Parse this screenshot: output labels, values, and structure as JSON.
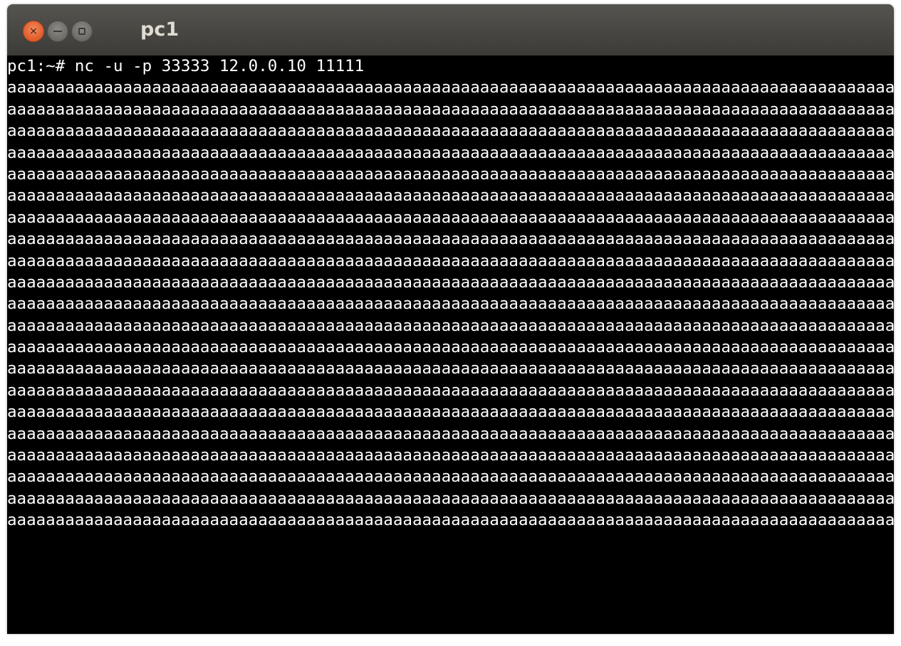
{
  "window": {
    "title": "pc1",
    "buttons": {
      "close_glyph": "×"
    }
  },
  "terminal": {
    "command_line": "pc1:~# nc -u -p 33333 12.0.0.10 11111",
    "output_lines": [
      "aaaaaaaaaaaaaaaaaaaaaaaaaaaaaaaaaaaaaaaaaaaaaaaaaaaaaaaaaaaaaaaaaaaaaaaaaaaaaaaaaaaaaaaaaaaaaaaaaaaaaaaaaaaaaaaaaaaaaaaa",
      "aaaaaaaaaaaaaaaaaaaaaaaaaaaaaaaaaaaaaaaaaaaaaaaaaaaaaaaaaaaaaaaaaaaaaaaaaaaaaaaaaaaaaaaaaaaaaaaaaaaaaaaaaaaaaaaaaaaaaaaa",
      "aaaaaaaaaaaaaaaaaaaaaaaaaaaaaaaaaaaaaaaaaaaaaaaaaaaaaaaaaaaaaaaaaaaaaaaaaaaaaaaaaaaaaaaaaaaaaaaaaaaaaaaaaaaaaaaaaaaaaaaa",
      "aaaaaaaaaaaaaaaaaaaaaaaaaaaaaaaaaaaaaaaaaaaaaaaaaaaaaaaaaaaaaaaaaaaaaaaaaaaaaaaaaaaaaaaaaaaaaaaaaaaaaaaaaaaaaaaaaaaaaaaa",
      "aaaaaaaaaaaaaaaaaaaaaaaaaaaaaaaaaaaaaaaaaaaaaaaaaaaaaaaaaaaaaaaaaaaaaaaaaaaaaaaaaaaaaaaaaaaaaaaaaaaaaaaaaaaaaaaaaaaaaaaa",
      "aaaaaaaaaaaaaaaaaaaaaaaaaaaaaaaaaaaaaaaaaaaaaaaaaaaaaaaaaaaaaaaaaaaaaaaaaaaaaaaaaaaaaaaaaaaaaaaaaaaaaaaaaaaaaaaaaaaaaaaa",
      "aaaaaaaaaaaaaaaaaaaaaaaaaaaaaaaaaaaaaaaaaaaaaaaaaaaaaaaaaaaaaaaaaaaaaaaaaaaaaaaaaaaaaaaaaaaaaaaaaaaaaaaaaaaaaaaaaaaaaaaa",
      "aaaaaaaaaaaaaaaaaaaaaaaaaaaaaaaaaaaaaaaaaaaaaaaaaaaaaaaaaaaaaaaaaaaaaaaaaaaaaaaaaaaaaaaaaaaaaaaaaaaaaaaaaaaaaaaaaaaaaaaa",
      "aaaaaaaaaaaaaaaaaaaaaaaaaaaaaaaaaaaaaaaaaaaaaaaaaaaaaaaaaaaaaaaaaaaaaaaaaaaaaaaaaaaaaaaaaaaaaaaaaaaaaaaaaaaaaaaaaaaaaaaa",
      "aaaaaaaaaaaaaaaaaaaaaaaaaaaaaaaaaaaaaaaaaaaaaaaaaaaaaaaaaaaaaaaaaaaaaaaaaaaaaaaaaaaaaaaaaaaaaaaaaaaaaaaaaaaaaaaaaaaaaaaa",
      "aaaaaaaaaaaaaaaaaaaaaaaaaaaaaaaaaaaaaaaaaaaaaaaaaaaaaaaaaaaaaaaaaaaaaaaaaaaaaaaaaaaaaaaaaaaaaaaaaaaaaaaaaaaaaaaaaaaaaaaa",
      "aaaaaaaaaaaaaaaaaaaaaaaaaaaaaaaaaaaaaaaaaaaaaaaaaaaaaaaaaaaaaaaaaaaaaaaaaaaaaaaaaaaaaaaaaaaaaaaaaaaaaaaaaaaaaaaaaaaaaaaa",
      "aaaaaaaaaaaaaaaaaaaaaaaaaaaaaaaaaaaaaaaaaaaaaaaaaaaaaaaaaaaaaaaaaaaaaaaaaaaaaaaaaaaaaaaaaaaaaaaaaaaaaaaaaaaaaaaaaaaaaaaa",
      "aaaaaaaaaaaaaaaaaaaaaaaaaaaaaaaaaaaaaaaaaaaaaaaaaaaaaaaaaaaaaaaaaaaaaaaaaaaaaaaaaaaaaaaaaaaaaaaaaaaaaaaaaaaaaaaaaaaaaaaa",
      "aaaaaaaaaaaaaaaaaaaaaaaaaaaaaaaaaaaaaaaaaaaaaaaaaaaaaaaaaaaaaaaaaaaaaaaaaaaaaaaaaaaaaaaaaaaaaaaaaaaaaaaaaaaaaaaaaaaaaaaa",
      "aaaaaaaaaaaaaaaaaaaaaaaaaaaaaaaaaaaaaaaaaaaaaaaaaaaaaaaaaaaaaaaaaaaaaaaaaaaaaaaaaaaaaaaaaaaaaaaaaaaaaaaaaaaaaaaaaaaaaaaa",
      "aaaaaaaaaaaaaaaaaaaaaaaaaaaaaaaaaaaaaaaaaaaaaaaaaaaaaaaaaaaaaaaaaaaaaaaaaaaaaaaaaaaaaaaaaaaaaaaaaaaaaaaaaaaaaaaaaaaaaaaa",
      "aaaaaaaaaaaaaaaaaaaaaaaaaaaaaaaaaaaaaaaaaaaaaaaaaaaaaaaaaaaaaaaaaaaaaaaaaaaaaaaaaaaaaaaaaaaaaaaaaaaaaaaaaaaaaaaaaaaaaaaa",
      "aaaaaaaaaaaaaaaaaaaaaaaaaaaaaaaaaaaaaaaaaaaaaaaaaaaaaaaaaaaaaaaaaaaaaaaaaaaaaaaaaaaaaaaaaaaaaaaaaaaaaaaaaaaaaaaaaaaaaaaa",
      "aaaaaaaaaaaaaaaaaaaaaaaaaaaaaaaaaaaaaaaaaaaaaaaaaaaaaaaaaaaaaaaaaaaaaaaaaaaaaaaaaaaaaaaaaaaaaaaaaaaaaaaaaaaaaaaaaaaaaaa"
    ],
    "last_line_text": "aaaaaaaaaaaaaaaaaaaaaaaaaaaaaaaaaaaaaaaaaaaaaaaaaaaaaaaaaaaaaaaaaaaaaaaaaaaaaaaaaaaaaaaaaaaaaaaaaaaaaaaaaaaaaaaaaaaaaaa",
    "cursor_char": "a"
  }
}
